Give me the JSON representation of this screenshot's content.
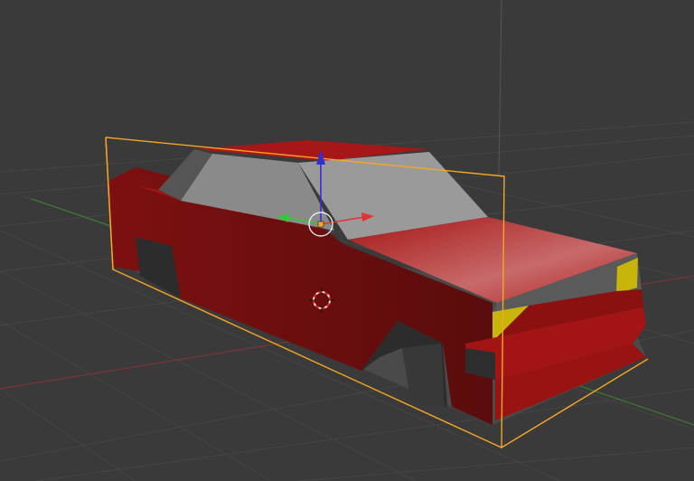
{
  "viewport": {
    "background": "#3a3a3a",
    "grid_color": "#464646",
    "x_axis_color": "#8a3a3a",
    "y_axis_color": "#4a8a3a",
    "z_axis_color": "#5a5a5a"
  },
  "selection": {
    "outline_color": "#f5a623"
  },
  "gizmo": {
    "x_color": "#e33232",
    "y_color": "#36c736",
    "z_color": "#2f2fd8",
    "origin_color": "#f5a623"
  },
  "icons": {
    "cursor": "3d-cursor-icon",
    "manipulator": "transform-manipulator-icon"
  },
  "model": {
    "body_color": "#8c1111",
    "glass_color": "#8e8e8e",
    "headlight_color": "#c8b40a"
  }
}
